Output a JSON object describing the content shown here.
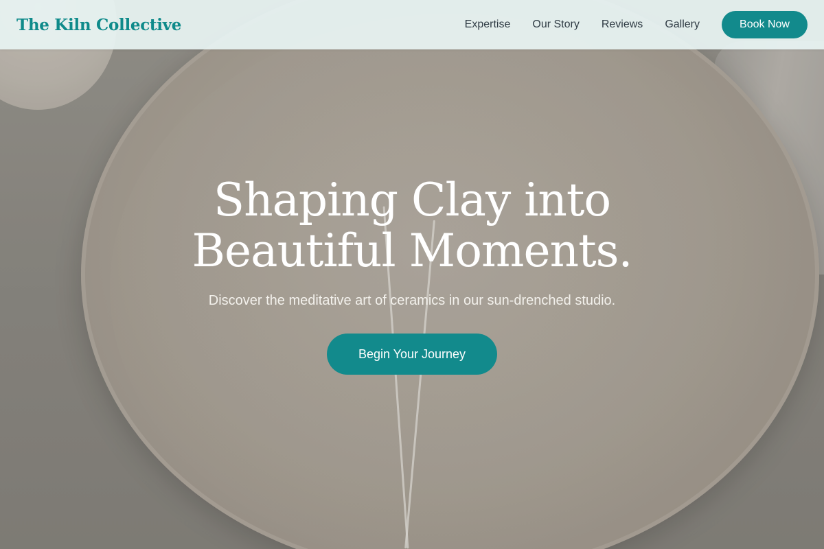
{
  "brand": {
    "name": "The Kiln Collective"
  },
  "nav": {
    "links": [
      "Expertise",
      "Our Story",
      "Reviews",
      "Gallery"
    ],
    "cta_label": "Book Now"
  },
  "hero": {
    "title_line1": "Shaping Clay into",
    "title_line2": "Beautiful Moments.",
    "subtitle": "Discover the meditative art of ceramics in our sun-drenched studio.",
    "cta_label": "Begin Your Journey"
  },
  "colors": {
    "accent": "#128a8c",
    "brand_text": "#0e8a8a",
    "nav_background": "#e8f4f3"
  }
}
